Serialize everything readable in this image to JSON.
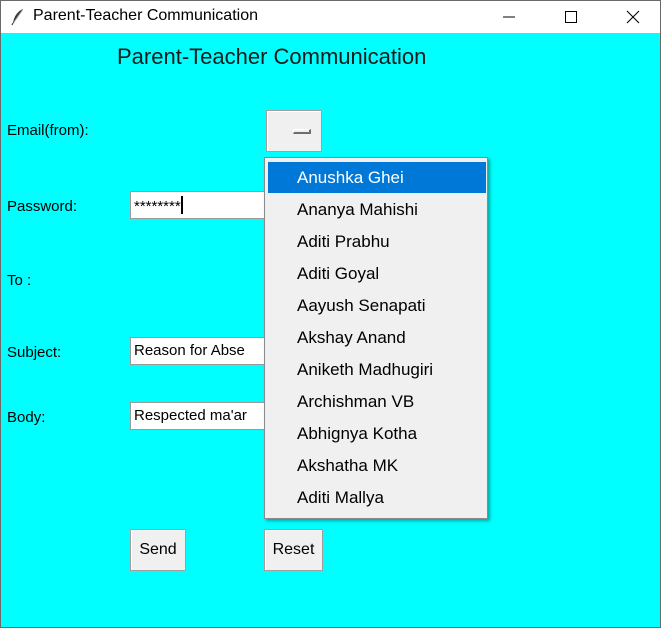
{
  "window": {
    "title": "Parent-Teacher Communication"
  },
  "form": {
    "heading": "Parent-Teacher Communication",
    "email_label": "Email(from):",
    "password_label": "Password:",
    "password_value": "********",
    "to_label": "To :",
    "subject_label": "Subject:",
    "subject_value": "Reason for Abse",
    "body_label": "Body:",
    "body_value": "Respected ma'ar",
    "send_label": "Send",
    "reset_label": "Reset"
  },
  "dropdown": {
    "selected_index": 0,
    "items": [
      "Anushka Ghei",
      "Ananya Mahishi",
      "Aditi Prabhu",
      "Aditi Goyal",
      "Aayush Senapati",
      "Akshay Anand",
      "Aniketh Madhugiri",
      "Archishman VB",
      "Abhignya Kotha",
      "Akshatha MK",
      "Aditi Mallya"
    ]
  },
  "colors": {
    "background": "#00ffff",
    "selection": "#0078d7"
  }
}
